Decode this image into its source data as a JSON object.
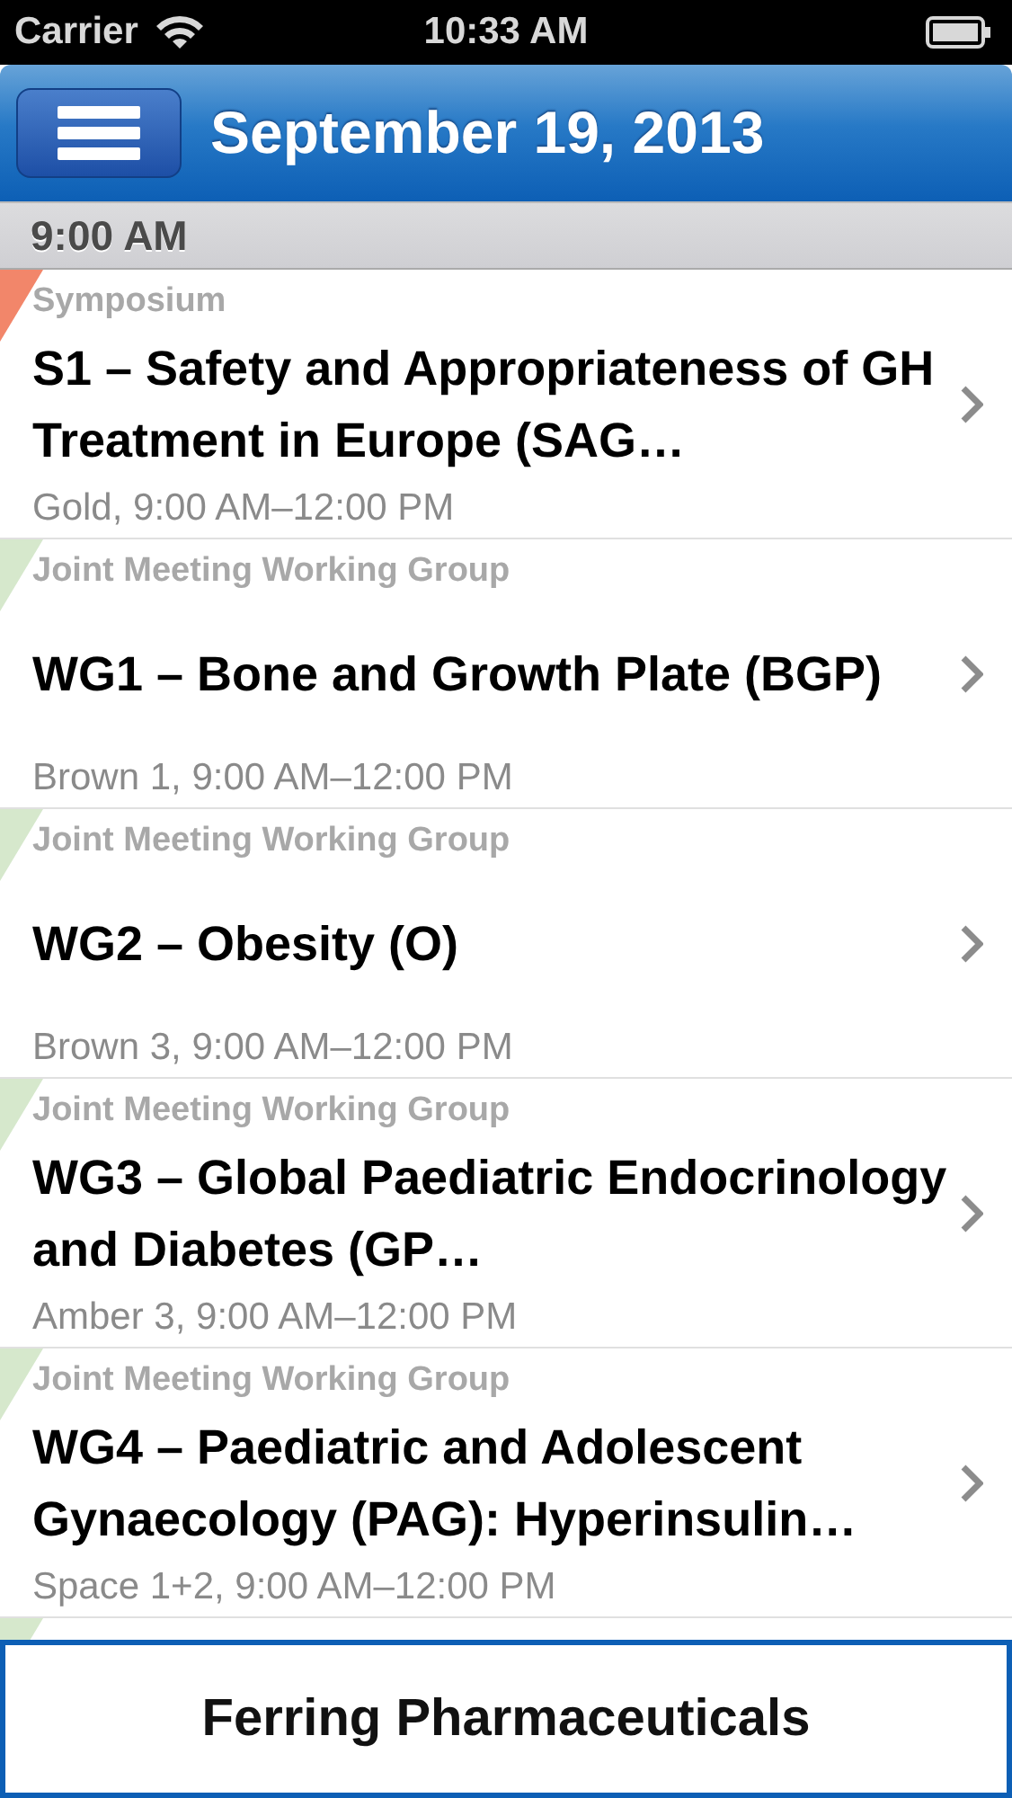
{
  "status_bar": {
    "carrier": "Carrier",
    "time": "10:33 AM"
  },
  "nav_bar": {
    "title": "September 19, 2013"
  },
  "section": {
    "header": "9:00 AM"
  },
  "sessions": [
    {
      "category": "Symposium",
      "title": "S1 – Safety and Appropriateness of GH Treatment in Europe (SAG…",
      "location": "Gold, 9:00 AM–12:00 PM",
      "color": "#f2866a"
    },
    {
      "category": "Joint Meeting Working Group",
      "title": "WG1 – Bone and Growth Plate (BGP)",
      "location": "Brown 1, 9:00 AM–12:00 PM",
      "color": "#d6e8cc"
    },
    {
      "category": "Joint Meeting Working Group",
      "title": "WG2 – Obesity (O)",
      "location": "Brown 3, 9:00 AM–12:00 PM",
      "color": "#d6e8cc"
    },
    {
      "category": "Joint Meeting Working Group",
      "title": "WG3 – Global Paediatric Endocrinology and Diabetes (GP…",
      "location": "Amber 3, 9:00 AM–12:00 PM",
      "color": "#d6e8cc"
    },
    {
      "category": "Joint Meeting Working Group",
      "title": "WG4 – Paediatric and Adolescent Gynaecology (PAG): Hyperinsulin…",
      "location": "Space 1+2, 9:00 AM–12:00 PM",
      "color": "#d6e8cc"
    },
    {
      "color": "#d6e8cc"
    }
  ],
  "banner": {
    "text": "Ferring Pharmaceuticals"
  }
}
